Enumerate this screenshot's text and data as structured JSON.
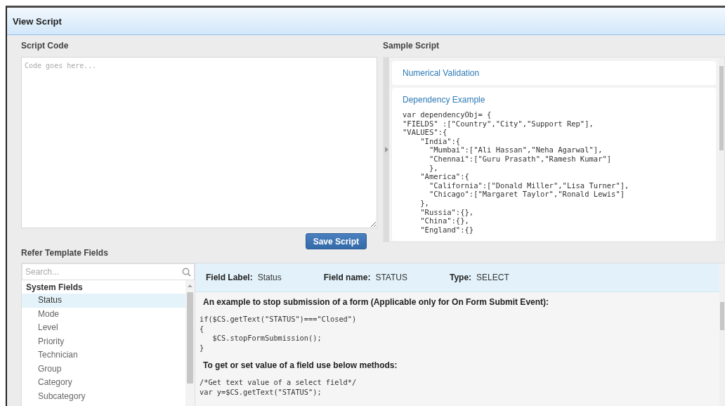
{
  "window": {
    "title": "View Script"
  },
  "script_code": {
    "label": "Script Code",
    "placeholder": "Code goes here...",
    "button": "Save Script"
  },
  "sample_script": {
    "label": "Sample Script",
    "items": [
      {
        "title": "Numerical Validation"
      },
      {
        "title": "Dependency Example",
        "code": [
          "var dependencyObj= {",
          "\"FIELDS\" :[\"Country\",\"City\",\"Support Rep\"],",
          "\"VALUES\":{",
          "    \"India\":{",
          "      \"Mumbai\":[\"Ali Hassan\",\"Neha Agarwal\"],",
          "      \"Chennai\":[\"Guru Prasath\",\"Ramesh Kumar\"]",
          "      },",
          "    \"America\":{",
          "      \"California\":[\"Donald Miller\",\"Lisa Turner\"],",
          "      \"Chicago\":[\"Margaret Taylor\",\"Ronald Lewis\"]",
          "    },",
          "    \"Russia\":{},",
          "    \"China\":{},",
          "    \"England\":{}"
        ]
      }
    ]
  },
  "template_fields": {
    "label": "Refer Template Fields",
    "search": {
      "placeholder": "Search..."
    },
    "groups": [
      {
        "name": "System Fields",
        "fields": [
          {
            "label": "Status",
            "selected": true
          },
          {
            "label": "Mode",
            "selected": false
          },
          {
            "label": "Level",
            "selected": false
          },
          {
            "label": "Priority",
            "selected": false
          },
          {
            "label": "Technician",
            "selected": false
          },
          {
            "label": "Group",
            "selected": false
          },
          {
            "label": "Category",
            "selected": false
          },
          {
            "label": "Subcategory",
            "selected": false
          }
        ]
      }
    ],
    "details": {
      "meta": [
        {
          "key": "Field Label:",
          "value": "Status"
        },
        {
          "key": "Field name:",
          "value": "STATUS"
        },
        {
          "key": "Type:",
          "value": "SELECT"
        }
      ],
      "sections": [
        {
          "heading": "An example to stop submission of a form (Applicable only for On Form Submit Event):",
          "code": [
            "if($CS.getText(\"STATUS\")===\"Closed\")",
            "{",
            "   $CS.stopFormSubmission();",
            "}"
          ]
        },
        {
          "heading": "To get or set value of a field use below methods:",
          "code": [
            "/*Get text value of a select field*/",
            "var y=$CS.getText(\"STATUS\");"
          ]
        }
      ]
    }
  }
}
